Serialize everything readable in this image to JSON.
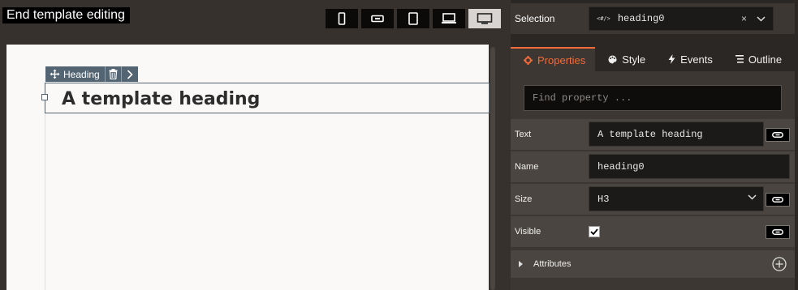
{
  "toolbar": {
    "end_template_label": "End template editing",
    "devices": [
      {
        "icon": "phone-portrait-icon"
      },
      {
        "icon": "phone-landscape-icon"
      },
      {
        "icon": "tablet-portrait-icon"
      },
      {
        "icon": "laptop-icon"
      },
      {
        "icon": "desktop-icon",
        "active": true
      }
    ]
  },
  "canvas": {
    "component_toolbar": {
      "label": "Heading",
      "icons": [
        "move-icon",
        "delete-icon",
        "chevron-right-icon"
      ]
    },
    "heading_text": "A template heading"
  },
  "panel": {
    "selection": {
      "label": "Selection",
      "icon_glyph": "<#/>",
      "value": "heading0",
      "clear_glyph": "×"
    },
    "tabs": [
      {
        "label": "Properties",
        "icon": "gear-icon",
        "active": true
      },
      {
        "label": "Style",
        "icon": "palette-icon"
      },
      {
        "label": "Events",
        "icon": "lightning-icon"
      },
      {
        "label": "Outline",
        "icon": "list-icon"
      }
    ],
    "find_placeholder": "Find property ...",
    "properties": {
      "text": {
        "label": "Text",
        "value": "A template heading"
      },
      "name": {
        "label": "Name",
        "value": "heading0"
      },
      "size": {
        "label": "Size",
        "value": "H3"
      },
      "visible": {
        "label": "Visible",
        "checked": true
      }
    },
    "attributes_label": "Attributes"
  },
  "colors": {
    "accent": "#f26b3a",
    "panel_bg": "#3c3733",
    "row_bg": "#4a4540",
    "selection_outline": "#536472"
  }
}
